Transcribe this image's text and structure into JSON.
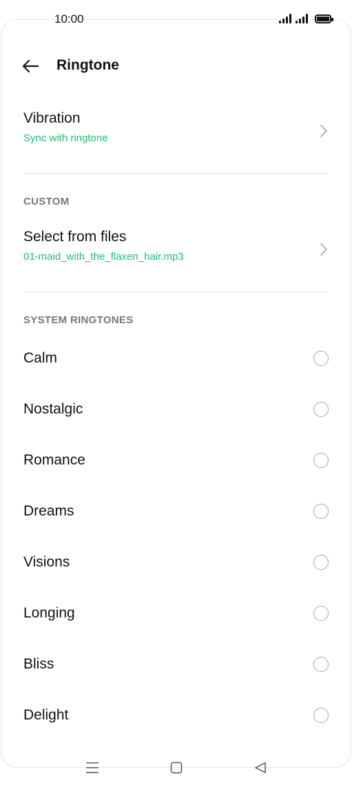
{
  "status_bar": {
    "time": "10:00"
  },
  "header": {
    "title": "Ringtone",
    "back_icon": "arrow-left-icon"
  },
  "vibration": {
    "title": "Vibration",
    "value": "Sync with ringtone"
  },
  "custom": {
    "section_label": "CUSTOM",
    "title": "Select from files",
    "value": "01-maid_with_the_flaxen_hair.mp3"
  },
  "system_ringtones": {
    "section_label": "SYSTEM RINGTONES",
    "items": [
      {
        "label": "Calm"
      },
      {
        "label": "Nostalgic"
      },
      {
        "label": "Romance"
      },
      {
        "label": "Dreams"
      },
      {
        "label": "Visions"
      },
      {
        "label": "Longing"
      },
      {
        "label": "Bliss"
      },
      {
        "label": "Delight"
      }
    ]
  },
  "colors": {
    "accent": "#1ebd73",
    "text": "#111111",
    "section": "#777777",
    "divider": "#e5e5e5"
  },
  "nav_bar": {
    "icons": [
      "menu-icon",
      "home-square-icon",
      "back-triangle-icon"
    ]
  }
}
